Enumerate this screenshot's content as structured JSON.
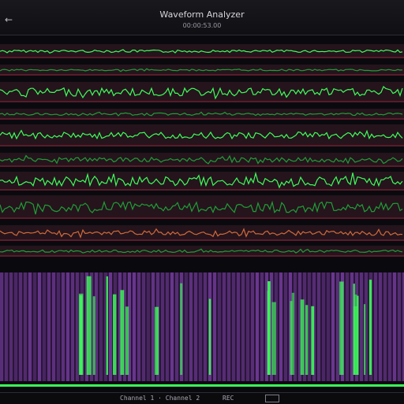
{
  "window": {
    "title": "Waveform Analyzer",
    "subtitle": "00:00:53.00",
    "back_icon": "back-arrow-icon"
  },
  "colors": {
    "background": "#0a0a0e",
    "track_bg": "#25141c",
    "track_line": "#6b1f2e",
    "wave_green": "#3cff5a",
    "wave_green_dim": "#1f9e37",
    "spectro_purple": "#7a3fa6",
    "orange_trace": "#d06a3a"
  },
  "status": {
    "left": "Channel 1 · Channel 2",
    "right": "REC"
  }
}
